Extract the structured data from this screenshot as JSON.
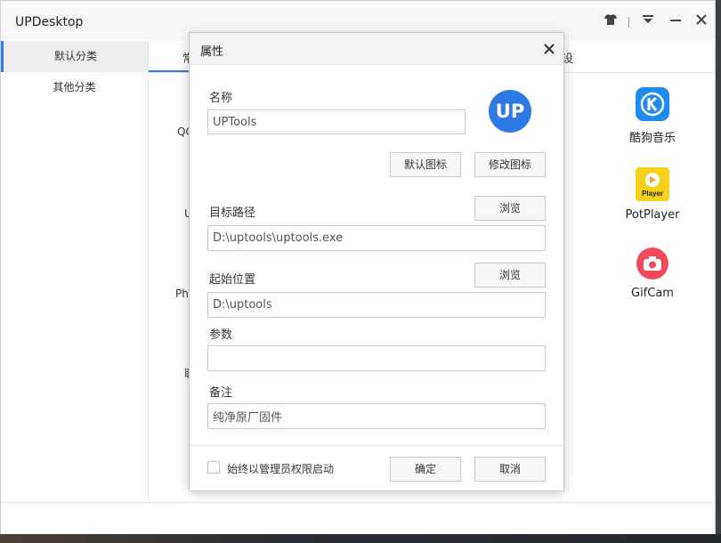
{
  "window": {
    "title": "UPDesktop",
    "controls": [
      "shirt-icon",
      "menu-icon",
      "minimize-icon",
      "close-icon"
    ]
  },
  "sidebar": {
    "items": [
      {
        "label": "默认分类",
        "active": true
      },
      {
        "label": "其他分类",
        "active": false
      }
    ]
  },
  "content": {
    "tab_partial_left": "常",
    "tab_partial_right": "设",
    "partial_labels": [
      "QC",
      "U",
      "Ph",
      "联"
    ],
    "apps": [
      {
        "name": "酷狗音乐",
        "icon": "kugou-icon",
        "color": "#1f8af2"
      },
      {
        "name": "PotPlayer",
        "icon": "potplayer-icon",
        "color": "#f6d21b"
      },
      {
        "name": "GifCam",
        "icon": "gifcam-icon",
        "color": "#f04a5b"
      }
    ]
  },
  "dialog": {
    "title": "属性",
    "name_label": "名称",
    "name_value": "UPTools",
    "logo_text": "UP",
    "default_icon_button": "默认图标",
    "modify_icon_button": "修改图标",
    "target_label": "目标路径",
    "target_value": "D:\\uptools\\uptools.exe",
    "browse_label": "浏览",
    "start_label": "起始位置",
    "start_value": "D:\\uptools",
    "params_label": "参数",
    "params_value": "",
    "note_label": "备注",
    "note_value": "纯净原厂固件",
    "admin_checkbox_label": "始终以管理员权限启动",
    "admin_checked": false,
    "ok_button": "确定",
    "cancel_button": "取消"
  },
  "colors": {
    "accent": "#2f7be5",
    "logo": "#2d7ae6"
  }
}
